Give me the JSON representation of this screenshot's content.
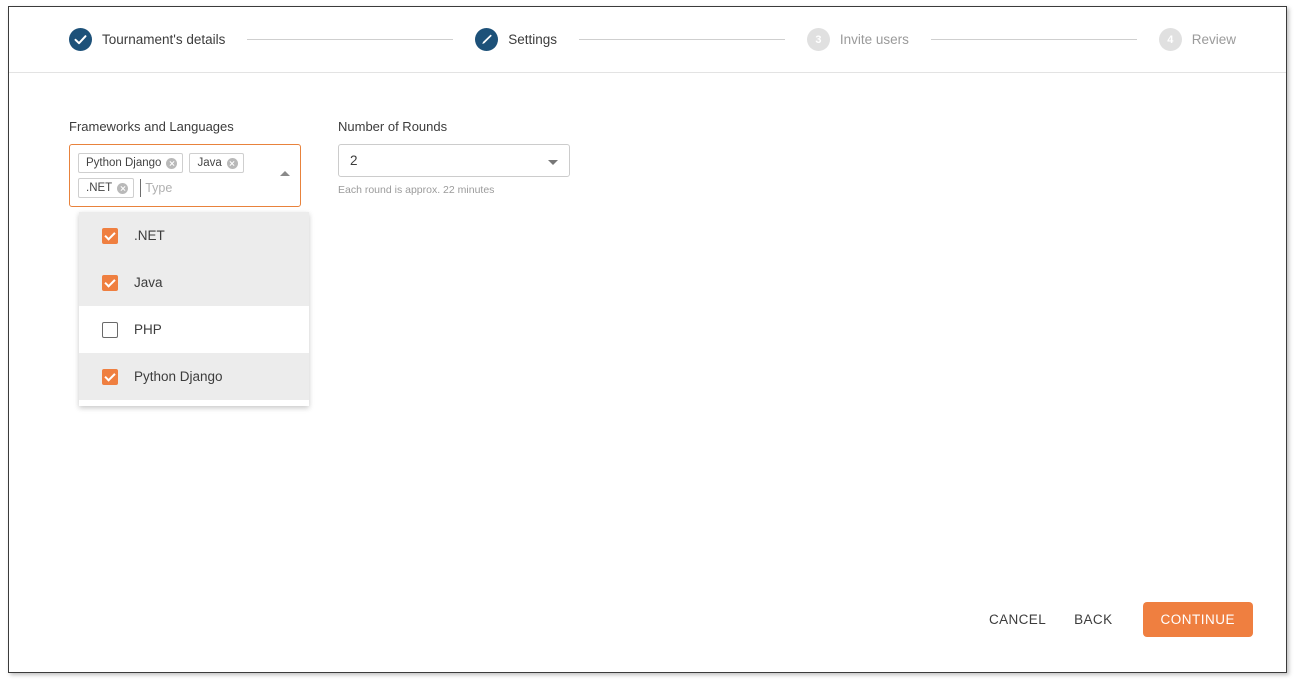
{
  "stepper": {
    "steps": [
      {
        "label": "Tournament's details",
        "state": "done",
        "icon": "check-icon",
        "number": "1"
      },
      {
        "label": "Settings",
        "state": "active",
        "icon": "pencil-icon",
        "number": "2"
      },
      {
        "label": "Invite users",
        "state": "todo",
        "icon": "number",
        "number": "3"
      },
      {
        "label": "Review",
        "state": "todo",
        "icon": "number",
        "number": "4"
      }
    ]
  },
  "form": {
    "frameworks": {
      "label": "Frameworks and Languages",
      "placeholder": "Type",
      "input_value": "",
      "chips": [
        "Python Django",
        "Java",
        ".NET"
      ],
      "dropdown_options": [
        {
          "label": ".NET",
          "checked": true
        },
        {
          "label": "Java",
          "checked": true
        },
        {
          "label": "PHP",
          "checked": false
        },
        {
          "label": "Python Django",
          "checked": true
        }
      ]
    },
    "rounds": {
      "label": "Number of Rounds",
      "value": "2",
      "helper": "Each round is approx. 22 minutes"
    }
  },
  "footer": {
    "cancel": "CANCEL",
    "back": "BACK",
    "continue": "CONTINUE"
  },
  "colors": {
    "accent_orange": "#ef7f40",
    "step_navy": "#1d5179",
    "step_inactive": "#e0e0e0",
    "text_dark": "#3c3c3c",
    "text_muted": "#9b9b9b",
    "row_selected": "#ececec"
  }
}
